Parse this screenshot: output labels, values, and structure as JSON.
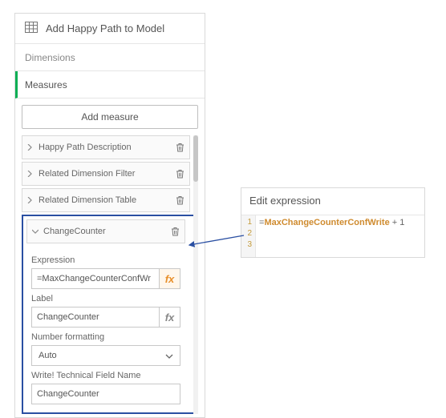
{
  "header": {
    "title": "Add Happy Path to Model"
  },
  "tabs": {
    "dimensions": "Dimensions",
    "measures": "Measures"
  },
  "add_measure_label": "Add measure",
  "measures": [
    {
      "label": "Happy Path Description"
    },
    {
      "label": "Related Dimension Filter"
    },
    {
      "label": "Related Dimension Table"
    }
  ],
  "expanded": {
    "row_label": "ChangeCounter",
    "expression_label": "Expression",
    "expression_value": "=MaxChangeCounterConfWr",
    "label_label": "Label",
    "label_value": "ChangeCounter",
    "numfmt_label": "Number formatting",
    "numfmt_value": "Auto",
    "techfield_label": "Write! Technical Field Name",
    "techfield_value": "ChangeCounter"
  },
  "editor": {
    "title": "Edit expression",
    "line1_eq": "=",
    "line1_ident": "MaxChangeCounterConfWrite",
    "line1_suffix": " + 1",
    "gutter": [
      "1",
      "2",
      "3"
    ]
  }
}
